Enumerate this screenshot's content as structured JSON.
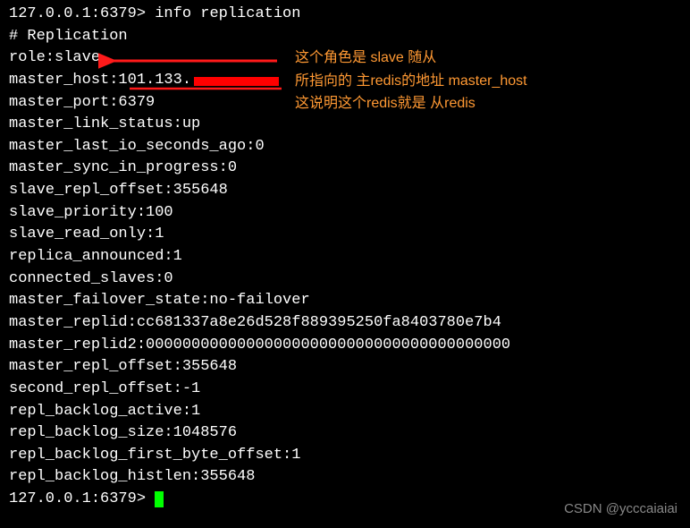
{
  "prompt1": "127.0.0.1:6379> ",
  "command": "info replication",
  "header": "# Replication",
  "lines": [
    "role:slave",
    "master_host:101.133.",
    "master_port:6379",
    "master_link_status:up",
    "master_last_io_seconds_ago:0",
    "master_sync_in_progress:0",
    "slave_repl_offset:355648",
    "slave_priority:100",
    "slave_read_only:1",
    "replica_announced:1",
    "connected_slaves:0",
    "master_failover_state:no-failover",
    "master_replid:cc681337a8e26d528f889395250fa8403780e7b4",
    "master_replid2:0000000000000000000000000000000000000000",
    "master_repl_offset:355648",
    "second_repl_offset:-1",
    "repl_backlog_active:1",
    "repl_backlog_size:1048576",
    "repl_backlog_first_byte_offset:1",
    "repl_backlog_histlen:355648"
  ],
  "prompt2": "127.0.0.1:6379> ",
  "annotations": {
    "line1": "这个角色是 slave 随从",
    "line2": "所指向的 主redis的地址 master_host",
    "line3": "这说明这个redis就是 从redis"
  },
  "watermark": "CSDN @ycccaiaiai"
}
